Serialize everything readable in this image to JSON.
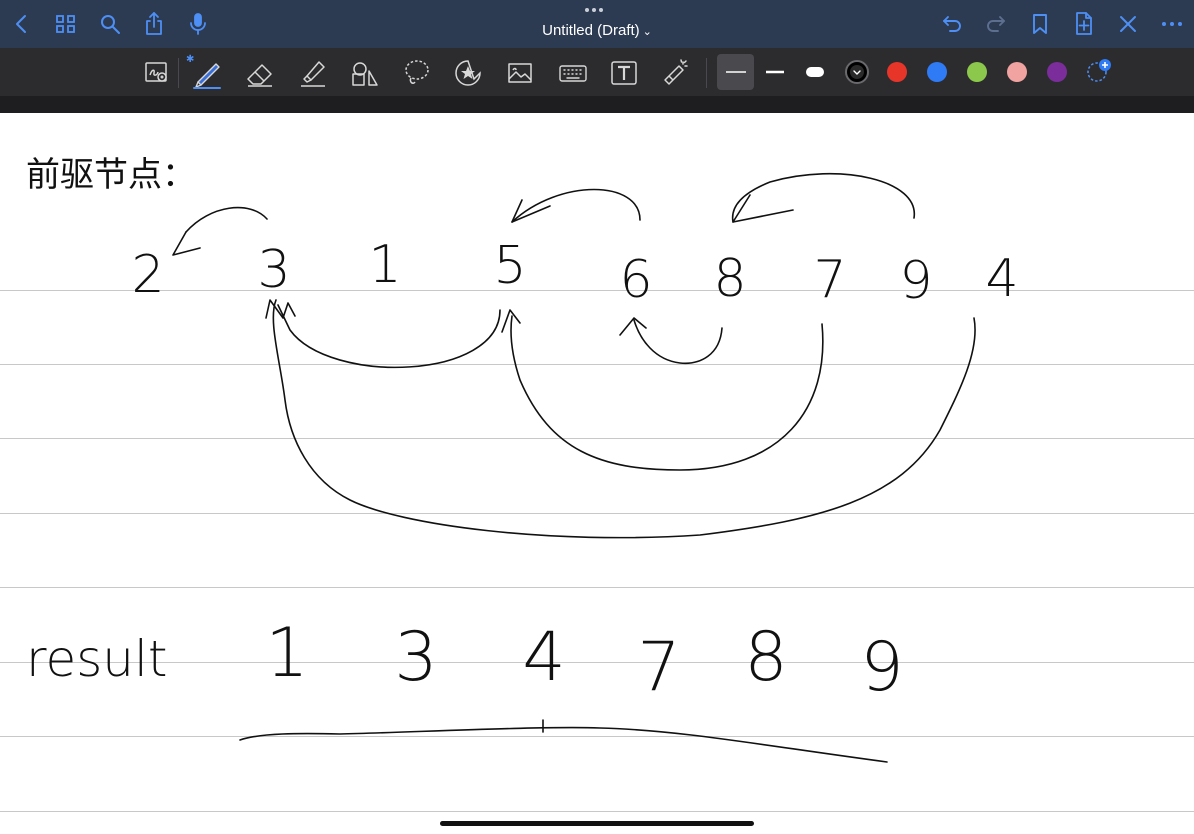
{
  "document": {
    "title": "Untitled (Draft)"
  },
  "nav": {
    "icons": [
      "back-icon",
      "grid-icon",
      "search-icon",
      "share-icon",
      "mic-icon"
    ],
    "right_icons": [
      "undo-icon",
      "redo-icon",
      "bookmark-icon",
      "add-page-icon",
      "close-icon",
      "more-icon"
    ]
  },
  "tools": {
    "items": [
      "zoom-box-icon",
      "pen-icon",
      "eraser-icon",
      "highlighter-icon",
      "shapes-icon",
      "lasso-icon",
      "sticker-icon",
      "image-icon",
      "keyboard-icon",
      "text-box-icon",
      "laser-pointer-icon"
    ],
    "stroke_sizes": [
      "thin",
      "medium",
      "thick"
    ],
    "selected_stroke": "thin",
    "colors": [
      "#000000",
      "#e8352a",
      "#2f7bf5",
      "#8cc84b",
      "#f0a3a0",
      "#7b2d9c"
    ],
    "selected_color": "#000000"
  },
  "colors": {
    "topbar": "#2d3b52",
    "toolbar": "#2c2c2e",
    "accent": "#4d8ff5",
    "paper": "#ffffff",
    "ruled_line": "#c8c8c8",
    "ink": "#000000"
  },
  "notes": {
    "heading": "前驱节点：",
    "sequence": [
      "2",
      "3",
      "1",
      "5",
      "6",
      "8",
      "7",
      "9",
      "4"
    ],
    "result_label": "result",
    "result": [
      "1",
      "3",
      "4",
      "7",
      "8",
      "9"
    ]
  }
}
